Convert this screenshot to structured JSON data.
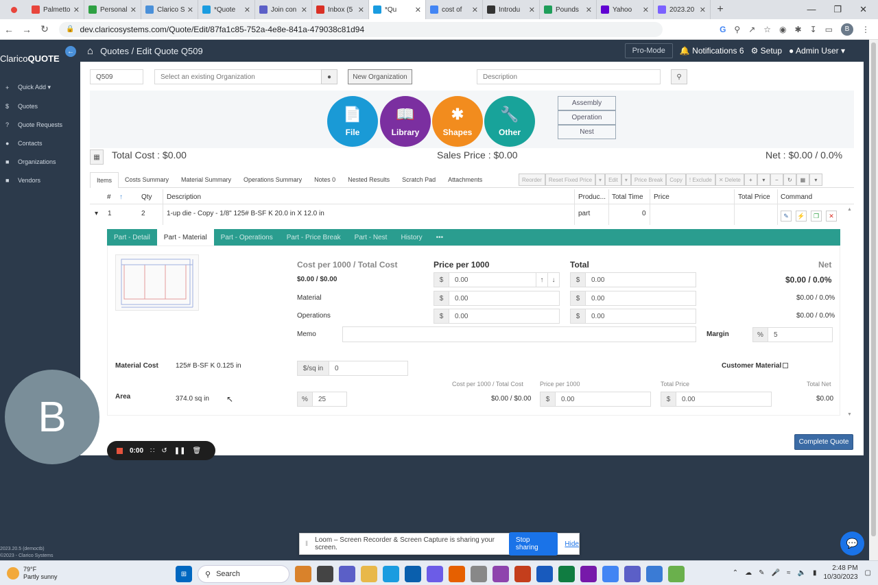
{
  "browser": {
    "tabs": [
      {
        "title": "Palmetto",
        "color": "#e8453c"
      },
      {
        "title": "Personal",
        "color": "#2ea043"
      },
      {
        "title": "Clarico S",
        "color": "#4a90d9"
      },
      {
        "title": "*Quote",
        "color": "#1a9ce0"
      },
      {
        "title": "Join con",
        "color": "#5b5fc7"
      },
      {
        "title": "Inbox (5",
        "color": "#d93025"
      },
      {
        "title": "*Qu",
        "color": "#1a9ce0"
      },
      {
        "title": "cost of",
        "color": "#4285f4"
      },
      {
        "title": "Introdu",
        "color": "#333333"
      },
      {
        "title": "Pounds",
        "color": "#1f9e5a"
      },
      {
        "title": "Yahoo",
        "color": "#6001d2"
      },
      {
        "title": "2023.20",
        "color": "#7b61ff"
      }
    ],
    "url": "dev.claricosystems.com/Quote/Edit/87fa1c85-752a-4e8e-841a-479038c81d94",
    "profile_initial": "B"
  },
  "sidebar": {
    "logo_a": "Clarico",
    "logo_b": "QUOTE",
    "items": [
      {
        "icon": "+",
        "label": "Quick Add ▾"
      },
      {
        "icon": "$",
        "label": "Quotes"
      },
      {
        "icon": "?",
        "label": "Quote Requests"
      },
      {
        "icon": "●",
        "label": "Contacts"
      },
      {
        "icon": "■",
        "label": "Organizations"
      },
      {
        "icon": "■",
        "label": "Vendors"
      }
    ],
    "version": "2023.20.5 (democtb)",
    "copyright": "©2023 - Clarico Systems"
  },
  "topnav": {
    "quotes": "Quotes",
    "separator": "/",
    "edit": "Edit Quote Q509",
    "promode": "Pro-Mode",
    "notifications": "Notifications",
    "notif_count": "6",
    "setup": "Setup",
    "user": "Admin User ▾"
  },
  "quote": {
    "number": "Q509",
    "org_placeholder": "Select an existing Organization",
    "new_org": "New Organization",
    "desc_placeholder": "Description"
  },
  "circles": [
    {
      "label": "File",
      "color": "#1a9ad6"
    },
    {
      "label": "Library",
      "color": "#7b2fa0"
    },
    {
      "label": "Shapes",
      "color": "#f28c1e"
    },
    {
      "label": "Other",
      "color": "#18a39a"
    }
  ],
  "stack_buttons": [
    "Assembly",
    "Operation",
    "Nest"
  ],
  "totals": {
    "total_cost": "Total Cost : $0.00",
    "sales_price": "Sales Price : $0.00",
    "net": "Net : $0.00 / 0.0%"
  },
  "item_tabs": [
    "Items",
    "Costs Summary",
    "Material Summary",
    "Operations Summary",
    "Notes 0",
    "Nested Results",
    "Scratch Pad",
    "Attachments"
  ],
  "toolbar": [
    "Reorder",
    "Reset Fixed Price",
    "▾",
    "Edit",
    "▾",
    "Price Break",
    "Copy",
    "! Exclude",
    "✕ Delete",
    "+",
    "▾",
    "−",
    "↻",
    "▦",
    "▾"
  ],
  "grid": {
    "headers": {
      "num": "#",
      "sort": "↑",
      "qty": "Qty",
      "desc": "Description",
      "product": "Produc...",
      "time": "Total Time",
      "price": "Price",
      "total_price": "Total Price",
      "command": "Command"
    },
    "row": {
      "expand": "▾",
      "num": "1",
      "qty": "2",
      "desc": "1-up die - Copy - 1/8\" 125# B-SF K 20.0 in X 12.0 in",
      "product": "part",
      "time": "0"
    }
  },
  "sub_tabs": [
    "Part - Detail",
    "Part - Material",
    "Part - Operations",
    "Part - Price Break",
    "Part - Nest",
    "History",
    "•••"
  ],
  "material": {
    "h_cost": "Cost per 1000 / Total Cost",
    "h_price": "Price per 1000",
    "h_total": "Total",
    "h_net": "Net",
    "cost_value": "$0.00 / $0.00",
    "net_main": "$0.00 / 0.0%",
    "currency": "$",
    "rows": [
      {
        "label": "",
        "price": "0.00",
        "total": "0.00",
        "net": ""
      },
      {
        "label": "Material",
        "price": "0.00",
        "total": "0.00",
        "net": "$0.00 / 0.0%"
      },
      {
        "label": "Operations",
        "price": "0.00",
        "total": "0.00",
        "net": "$0.00 / 0.0%"
      }
    ],
    "memo_label": "Memo",
    "margin_label": "Margin",
    "margin_pre": "%",
    "margin_value": "5",
    "material_cost_label": "Material Cost",
    "material_cost_value": "125# B-SF K 0.125 in",
    "sqin_pre": "$/sq in",
    "sqin_value": "0",
    "customer_material": "Customer Material",
    "area_label": "Area",
    "area_value": "374.0 sq in",
    "pct_pre": "%",
    "pct_value": "25",
    "sub_h_cost": "Cost per 1000 / Total Cost",
    "sub_h_price": "Price per 1000",
    "sub_h_total": "Total Price",
    "sub_h_net": "Total Net",
    "sub_cost_value": "$0.00 / $0.00",
    "sub_price": "0.00",
    "sub_total": "0.00",
    "sub_net": "$0.00"
  },
  "complete_btn": "Complete Quote",
  "recorder": {
    "avatar": "B",
    "time": "0:00"
  },
  "loom": {
    "text": "Loom – Screen Recorder & Screen Capture is sharing your screen.",
    "stop": "Stop sharing",
    "hide": "Hide"
  },
  "taskbar": {
    "temp": "79°F",
    "weather": "Partly sunny",
    "search": "Search",
    "time": "2:48 PM",
    "date": "10/30/2023"
  }
}
